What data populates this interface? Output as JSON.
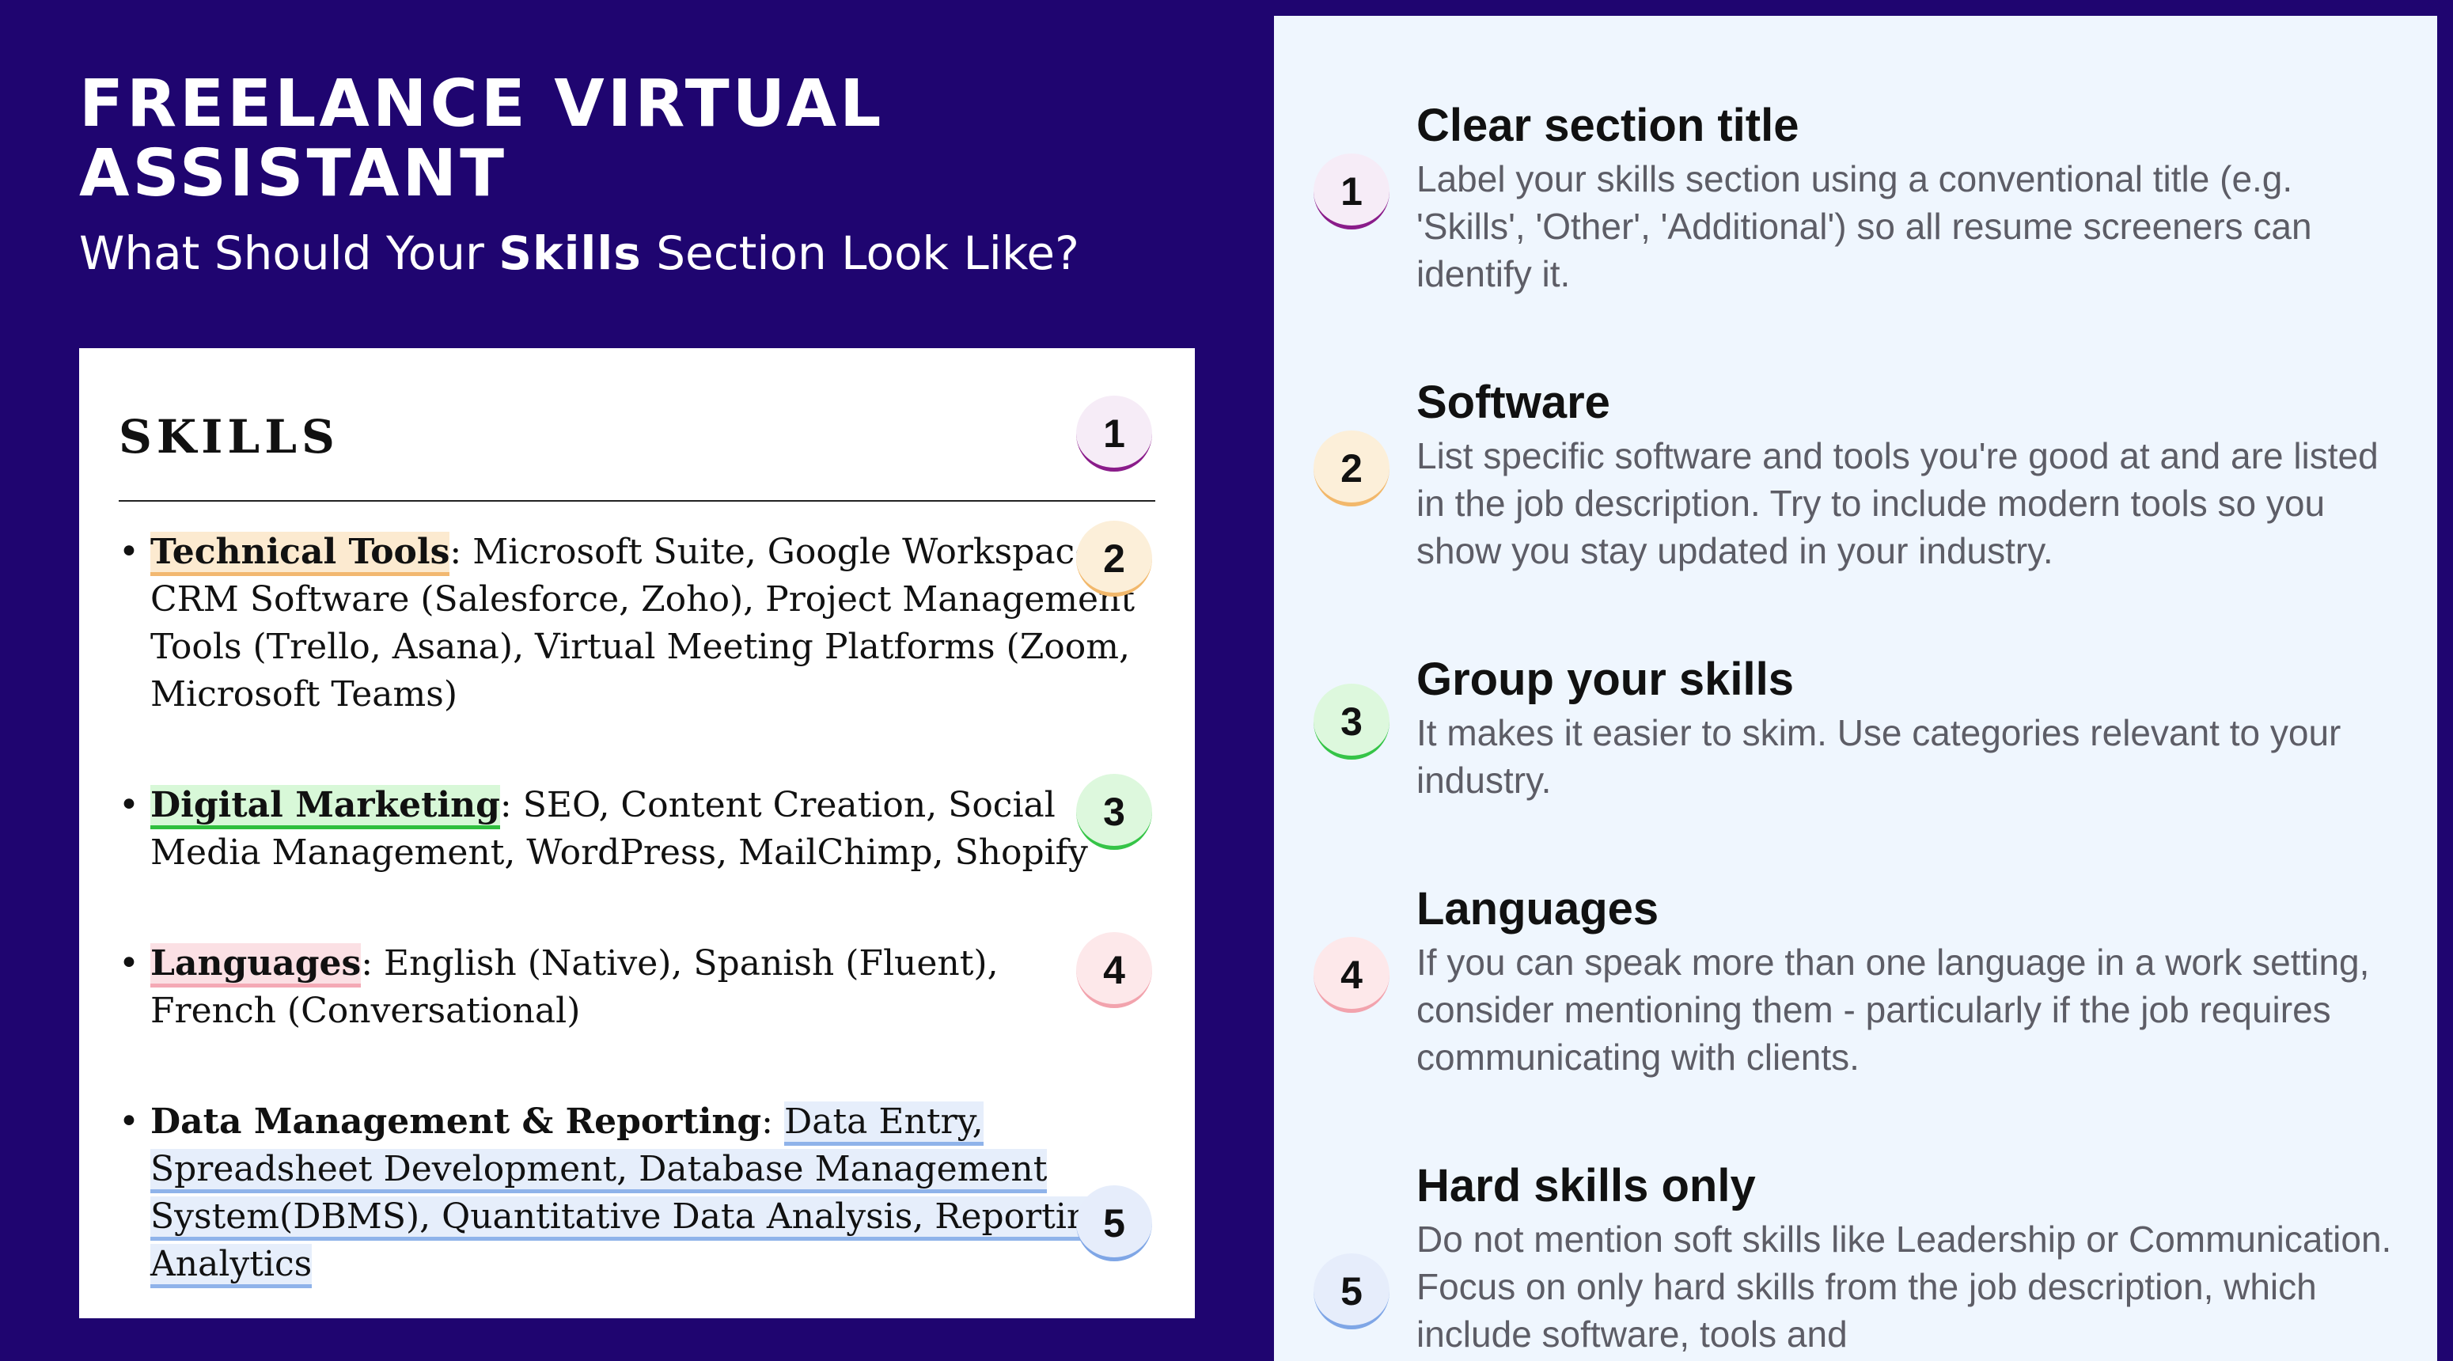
{
  "header": {
    "title": "FREELANCE VIRTUAL ASSISTANT",
    "subtitle_before": "What Should Your ",
    "subtitle_bold": "Skills",
    "subtitle_after": " Section Look Like?"
  },
  "resume": {
    "section_title": "SKILLS",
    "items": [
      {
        "category": "Technical Tools",
        "text": ": Microsoft Suite, Google Workspace, CRM Software (Salesforce, Zoho), Project Management Tools (Trello, Asana), Virtual Meeting Platforms (Zoom, Microsoft Teams)"
      },
      {
        "category": "Digital Marketing",
        "text": ": SEO, Content Creation, Social Media Management, WordPress, MailChimp, Shopify"
      },
      {
        "category": "Languages",
        "text": ": English (Native), Spanish (Fluent), French (Conversational)"
      },
      {
        "category": "Data Management & Reporting",
        "sep": ": ",
        "text": "Data Entry, Spreadsheet Development, Database Management System(DBMS), Quantitative Data Analysis, Reporting, Analytics"
      }
    ]
  },
  "badges": [
    "1",
    "2",
    "3",
    "4",
    "5"
  ],
  "tips": [
    {
      "number": "1",
      "title": "Clear section title",
      "body": "Label your skills section using a conventional title (e.g. 'Skills', 'Other', 'Additional') so all resume screeners can identify it."
    },
    {
      "number": "2",
      "title": "Software",
      "body": "List specific software and tools you're good at and are listed in the job description. Try to include modern tools so you show you stay updated in your industry."
    },
    {
      "number": "3",
      "title": "Group your skills",
      "body": "It makes it easier to skim. Use categories relevant to your industry."
    },
    {
      "number": "4",
      "title": "Languages",
      "body": "If you can speak more than one language in a work setting, consider mentioning them - particularly if the job requires communicating with clients."
    },
    {
      "number": "5",
      "title": "Hard skills only",
      "body": "Do not mention soft skills like Leadership or Communication. Focus on only hard skills from the job description, which include software, tools and"
    }
  ],
  "colors": {
    "background": "#1f0570",
    "panel": "#eff6fe",
    "badge_1": "#8a1c8a",
    "badge_2": "#f2b86b",
    "badge_3": "#35c447",
    "badge_4": "#f2a3ad",
    "badge_5": "#7fa6e6"
  }
}
